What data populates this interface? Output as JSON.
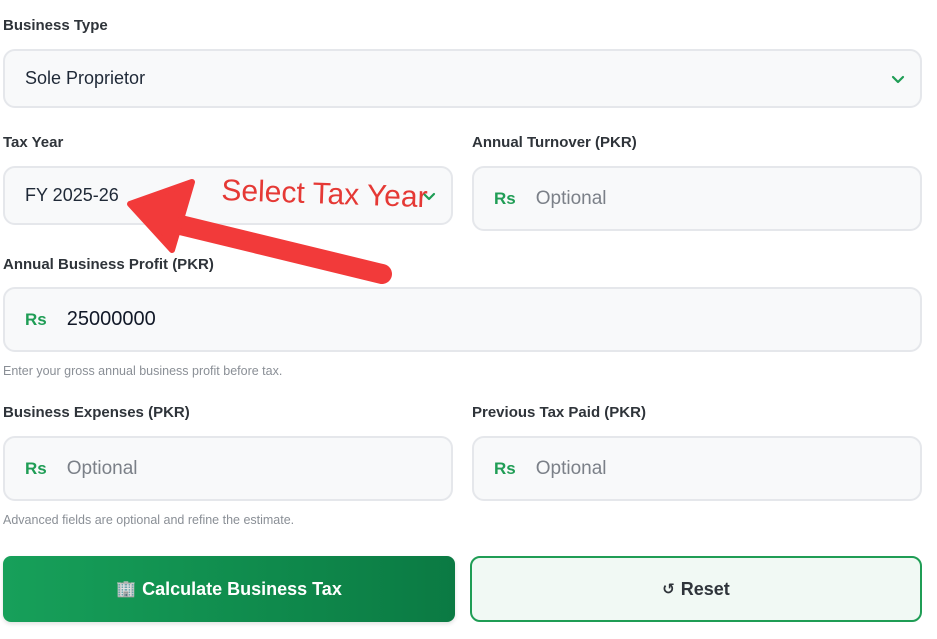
{
  "business_type": {
    "label": "Business Type",
    "value": "Sole Proprietor"
  },
  "tax_year": {
    "label": "Tax Year",
    "value": "FY 2025-26"
  },
  "annual_turnover": {
    "label": "Annual Turnover (PKR)",
    "prefix": "Rs",
    "placeholder": "Optional"
  },
  "annual_profit": {
    "label": "Annual Business Profit (PKR)",
    "prefix": "Rs",
    "value": "25000000",
    "help": "Enter your gross annual business profit before tax."
  },
  "business_expenses": {
    "label": "Business Expenses (PKR)",
    "prefix": "Rs",
    "placeholder": "Optional"
  },
  "previous_tax": {
    "label": "Previous Tax Paid (PKR)",
    "prefix": "Rs",
    "placeholder": "Optional"
  },
  "advanced_help": "Advanced fields are optional and refine the estimate.",
  "buttons": {
    "calculate_icon": "🏢",
    "calculate_label": "Calculate Business Tax",
    "reset_icon": "↺",
    "reset_label": "Reset"
  },
  "annotation": {
    "text": "Select Tax Year",
    "color": "#e53935"
  },
  "colors": {
    "accent": "#1f9d55",
    "annotation": "#e53935"
  }
}
